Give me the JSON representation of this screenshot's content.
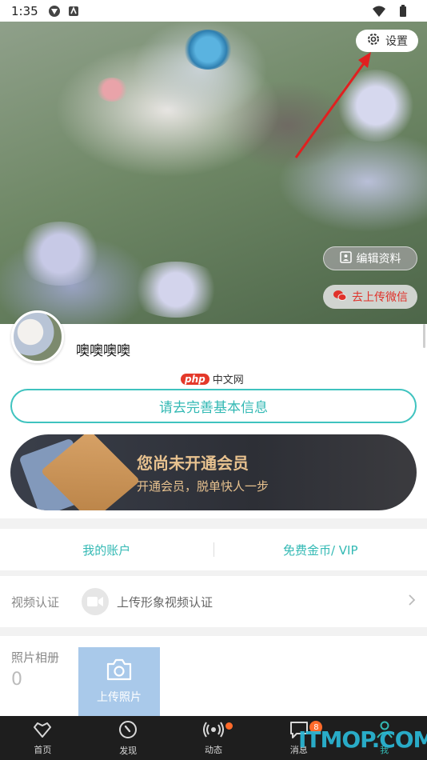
{
  "status_bar": {
    "time": "1:35"
  },
  "hero": {
    "settings_label": "设置",
    "edit_profile_label": "编辑资料",
    "upload_wechat_label": "去上传微信"
  },
  "profile": {
    "nickname": "噢噢噢噢"
  },
  "watermark": {
    "logo": "php",
    "text": "中文网"
  },
  "complete_info_button": "请去完善基本信息",
  "vip_banner": {
    "title": "您尚未开通会员",
    "subtitle": "开通会员，脱单快人一步"
  },
  "account_row": {
    "my_account": "我的账户",
    "free_coins": "免费金币/ VIP"
  },
  "video_verify": {
    "label": "视频认证",
    "text": "上传形象视频认证"
  },
  "album": {
    "label": "照片相册",
    "count": "0",
    "upload_label": "上传照片"
  },
  "bottom_nav": {
    "items": [
      {
        "label": "首页",
        "icon": "heart-outline-icon"
      },
      {
        "label": "发现",
        "icon": "compass-icon"
      },
      {
        "label": "动态",
        "icon": "broadcast-icon"
      },
      {
        "label": "消息",
        "icon": "chat-icon",
        "badge": "8"
      },
      {
        "label": "我",
        "icon": "person-icon"
      }
    ]
  },
  "site_watermark": "ITMOP.COM",
  "colors": {
    "accent": "#33b9b4",
    "vip_gold": "#e8c28f",
    "wechat_red": "#e0322b",
    "badge": "#ff6a2a"
  }
}
